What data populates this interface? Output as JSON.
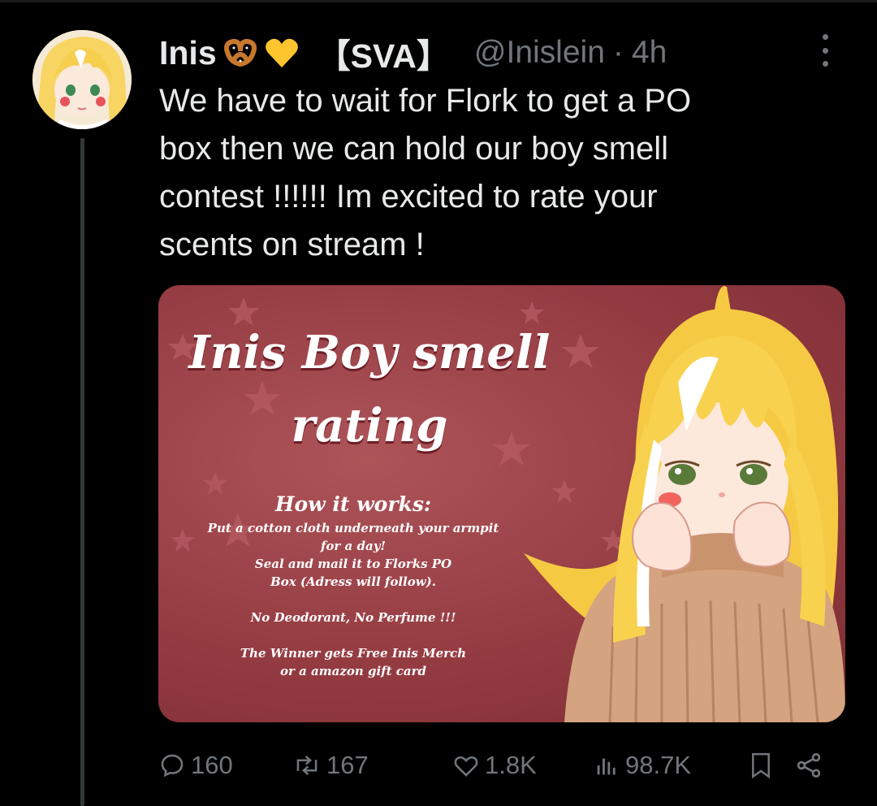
{
  "tweet": {
    "author": {
      "display_name": "Inis",
      "emojis": [
        "pretzel-emoji",
        "yellow-heart-emoji"
      ],
      "org_tag": "【SVA】",
      "handle": "@Inislein",
      "separator": "·",
      "time": "4h"
    },
    "text_lines": [
      "We have to wait for Flork to get a PO",
      "box then we can hold our boy smell",
      "contest !!!!!! Im excited to rate your",
      "scents on stream !"
    ],
    "media": {
      "title_lines": [
        "Inis Boy smell",
        "rating"
      ],
      "subtitle": "How it works:",
      "body_lines": [
        "Put a cotton cloth underneath your armpit",
        "for a day!",
        "Seal and mail it to Florks PO",
        "Box (Adress will follow).",
        "",
        "No Deodorant, No Perfume !!!",
        "",
        "The Winner gets Free Inis Merch",
        "or a amazon gift card"
      ]
    },
    "stats": {
      "replies": "160",
      "reposts": "167",
      "likes": "1.8K",
      "views": "98.7K"
    }
  },
  "icons": {
    "reply": "reply-icon",
    "repost": "repost-icon",
    "like": "heart-icon",
    "views": "views-icon",
    "bookmark": "bookmark-icon",
    "share": "share-icon",
    "more": "more-options-icon"
  },
  "colors": {
    "background": "#000000",
    "text": "#e7e9ea",
    "muted": "#71767b",
    "card": "#943b42",
    "hair": "#f7d35a"
  }
}
